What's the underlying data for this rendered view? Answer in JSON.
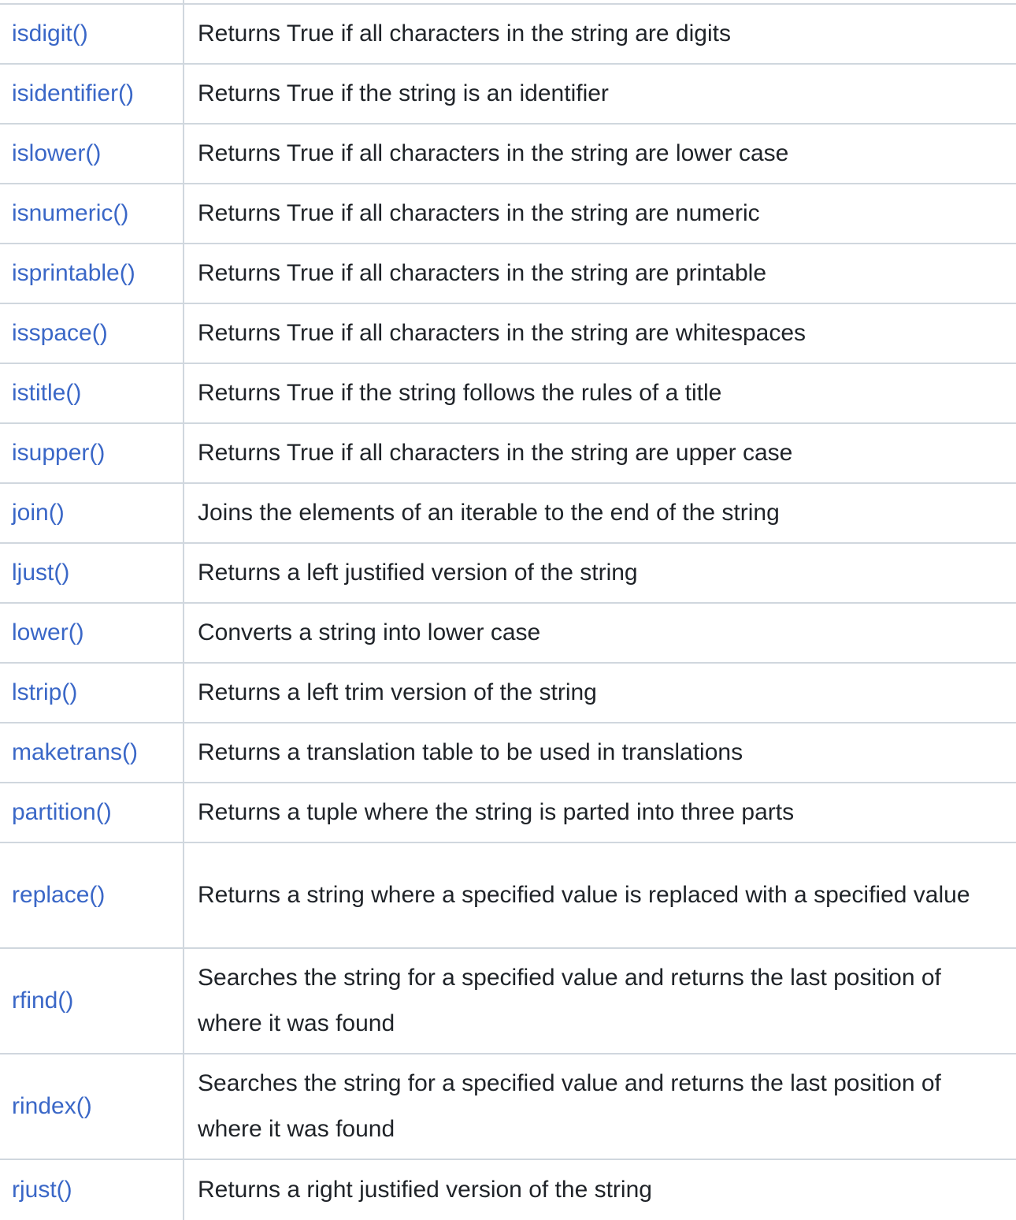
{
  "rows": [
    {
      "method": "isdigit()",
      "description": "Returns True if all characters in the string are digits"
    },
    {
      "method": "isidentifier()",
      "description": "Returns True if the string is an identifier"
    },
    {
      "method": "islower()",
      "description": "Returns True if all characters in the string are lower case"
    },
    {
      "method": "isnumeric()",
      "description": "Returns True if all characters in the string are numeric"
    },
    {
      "method": "isprintable()",
      "description": "Returns True if all characters in the string are printable"
    },
    {
      "method": "isspace()",
      "description": "Returns True if all characters in the string are whitespaces"
    },
    {
      "method": "istitle()",
      "description": "Returns True if the string follows the rules of a title"
    },
    {
      "method": "isupper()",
      "description": "Returns True if all characters in the string are upper case"
    },
    {
      "method": "join()",
      "description": "Joins the elements of an iterable to the end of the string"
    },
    {
      "method": "ljust()",
      "description": "Returns a left justified version of the string"
    },
    {
      "method": "lower()",
      "description": "Converts a string into lower case"
    },
    {
      "method": "lstrip()",
      "description": "Returns a left trim version of the string"
    },
    {
      "method": "maketrans()",
      "description": "Returns a translation table to be used in translations"
    },
    {
      "method": "partition()",
      "description": "Returns a tuple where the string is parted into three parts"
    },
    {
      "method": "replace()",
      "description": "Returns a string where a specified value is replaced with a specified value"
    },
    {
      "method": "rfind()",
      "description": "Searches the string for a specified value and returns the last position of where it was found"
    },
    {
      "method": "rindex()",
      "description": "Searches the string for a specified value and returns the last position of where it was found"
    },
    {
      "method": "rjust()",
      "description": "Returns a right justified version of the string"
    }
  ],
  "colors": {
    "link": "#3a67c7",
    "text": "#1f2328",
    "border": "#d0d7de"
  }
}
